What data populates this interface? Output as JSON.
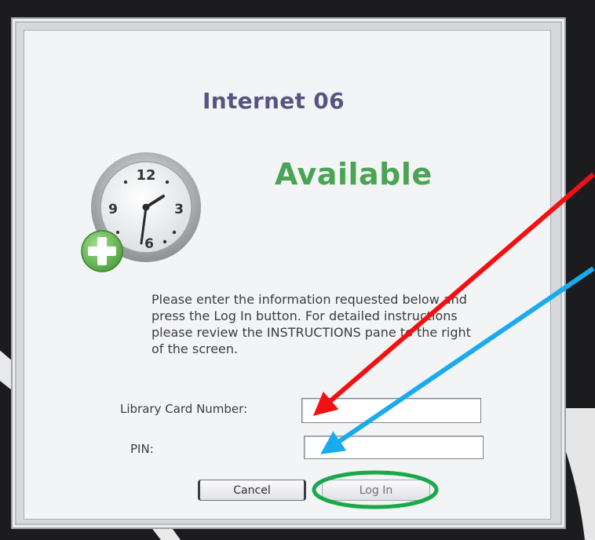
{
  "dialog": {
    "terminal_name": "Internet 06",
    "status": "Available",
    "instructions": "Please enter the information requested below and press the Log In button. For detailed instructions please review the INSTRUCTIONS pane to the right of the screen."
  },
  "form": {
    "card_label": "Library Card Number:",
    "card_value": "",
    "pin_label": "PIN:",
    "pin_value": ""
  },
  "buttons": {
    "cancel_label": "Cancel",
    "login_label": "Log In"
  },
  "clock": {
    "numerals": [
      "12",
      "3",
      "6",
      "9"
    ]
  },
  "colors": {
    "title": "#545682",
    "status": "#49a453",
    "arrow_red": "#f41010",
    "arrow_blue": "#19aaf0",
    "circle_green": "#1aa84a"
  },
  "annotations": [
    "red-arrow",
    "blue-arrow",
    "green-circle"
  ]
}
